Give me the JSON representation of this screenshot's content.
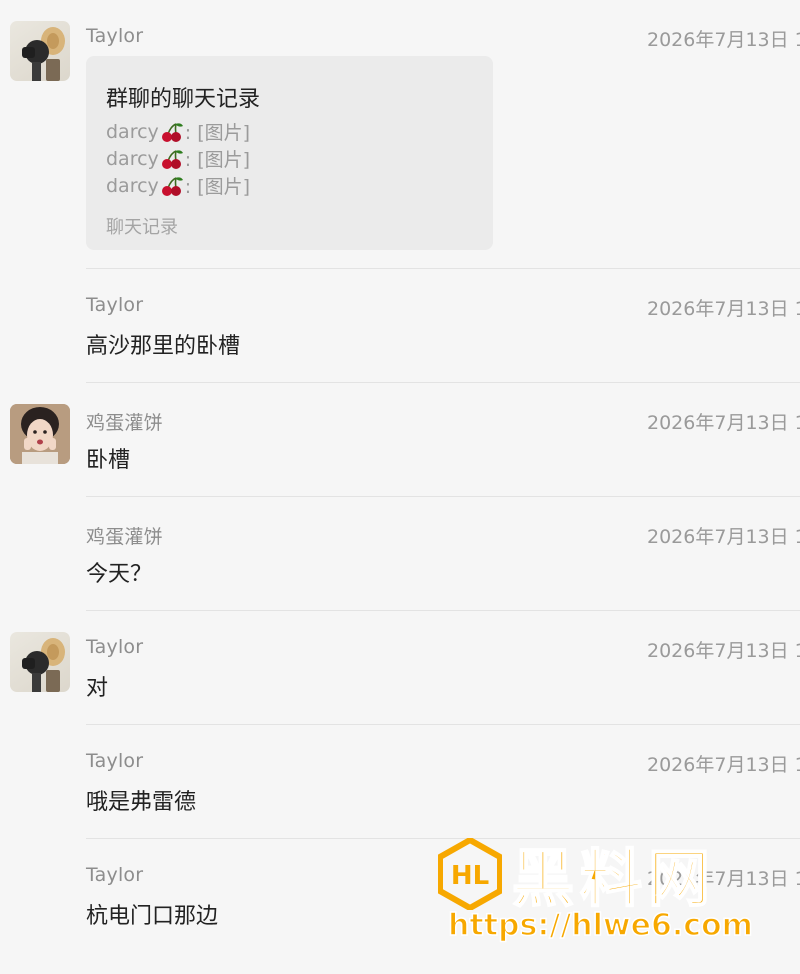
{
  "messages": [
    {
      "sender": "Taylor",
      "time": "2026年7月13日 1",
      "type": "chat-record",
      "record": {
        "title": "群聊的聊天记录",
        "lines": [
          {
            "sender": "darcy",
            "emoji": "cherries",
            "content": ": [图片]"
          },
          {
            "sender": "darcy",
            "emoji": "cherries",
            "content": ": [图片]"
          },
          {
            "sender": "darcy",
            "emoji": "cherries",
            "content": ": [图片]"
          }
        ],
        "footer": "聊天记录"
      }
    },
    {
      "sender": "Taylor",
      "time": "2026年7月13日 1",
      "text": "高沙那里的卧槽"
    },
    {
      "sender": "鸡蛋灌饼",
      "time": "2026年7月13日 1",
      "text": "卧槽"
    },
    {
      "sender": "鸡蛋灌饼",
      "time": "2026年7月13日 1",
      "text": "今天？"
    },
    {
      "sender": "Taylor",
      "time": "2026年7月13日 1",
      "text": "对"
    },
    {
      "sender": "Taylor",
      "time": "2026年7月13日 1",
      "text": "哦是弗雷德"
    },
    {
      "sender": "Taylor",
      "time": "2026年7月13日 1",
      "text": "杭电门口那边"
    }
  ],
  "watermark": {
    "logo_text": "HL",
    "title": "黑料网",
    "url": "https://hlwe6.com",
    "color": "#f7a800"
  },
  "colors": {
    "background": "#f6f6f6",
    "card": "#ebebeb",
    "name": "#8d8d8d",
    "text": "#222222"
  }
}
